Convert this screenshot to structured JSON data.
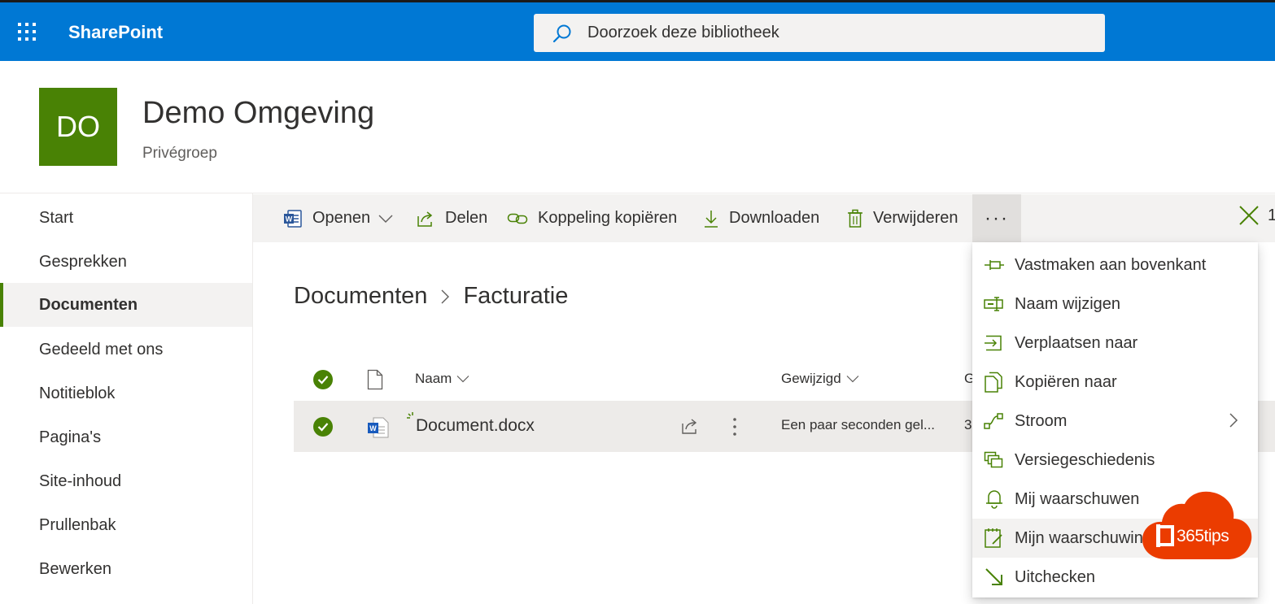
{
  "suite": {
    "brand": "SharePoint",
    "search_placeholder": "Doorzoek deze bibliotheek"
  },
  "site": {
    "logo_initials": "DO",
    "title": "Demo Omgeving",
    "subtitle": "Privégroep",
    "accent": "#498205"
  },
  "nav": {
    "items": [
      {
        "label": "Start"
      },
      {
        "label": "Gesprekken"
      },
      {
        "label": "Documenten",
        "active": true
      },
      {
        "label": "Gedeeld met ons"
      },
      {
        "label": "Notitieblok"
      },
      {
        "label": "Pagina's"
      },
      {
        "label": "Site-inhoud"
      },
      {
        "label": "Prullenbak"
      },
      {
        "label": "Bewerken"
      }
    ]
  },
  "commands": {
    "open": "Openen",
    "share": "Delen",
    "copy_link": "Koppeling kopiëren",
    "download": "Downloaden",
    "delete": "Verwijderen",
    "more": "···",
    "selected_count": "1"
  },
  "breadcrumb": {
    "root": "Documenten",
    "current": "Facturatie"
  },
  "list": {
    "columns": {
      "name": "Naam",
      "modified": "Gewijzigd",
      "third_truncated": "G"
    },
    "rows": [
      {
        "name": "Document.docx",
        "modified": "Een paar seconden gel...",
        "third_truncated": "3"
      }
    ]
  },
  "menu": {
    "items": [
      {
        "label": "Vastmaken aan bovenkant",
        "icon": "pin-icon"
      },
      {
        "label": "Naam wijzigen",
        "icon": "rename-icon"
      },
      {
        "label": "Verplaatsen naar",
        "icon": "move-icon"
      },
      {
        "label": "Kopiëren naar",
        "icon": "copy-icon"
      },
      {
        "label": "Stroom",
        "icon": "flow-icon",
        "submenu": true
      },
      {
        "label": "Versiegeschiedenis",
        "icon": "version-history-icon"
      },
      {
        "label": "Mij waarschuwen",
        "icon": "bell-icon"
      },
      {
        "label": "Mijn waarschuwin",
        "icon": "manage-alerts-icon"
      },
      {
        "label": "Uitchecken",
        "icon": "checkout-icon"
      }
    ]
  },
  "watermark": {
    "text": "365tips",
    "color": "#eb3c00"
  }
}
